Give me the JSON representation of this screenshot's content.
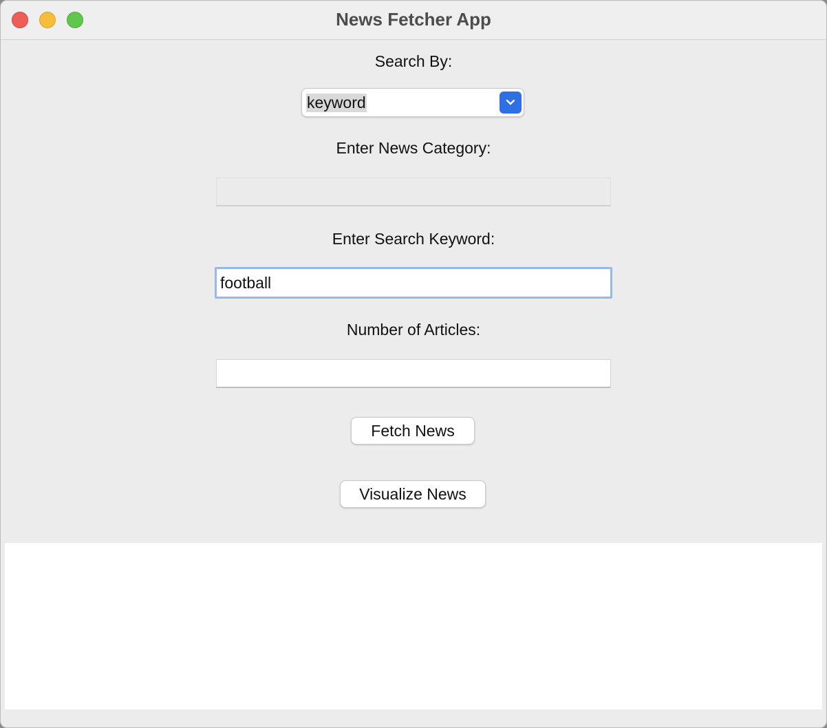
{
  "window": {
    "title": "News Fetcher App"
  },
  "form": {
    "search_by_label": "Search By:",
    "search_by_value": "keyword",
    "category_label": "Enter News Category:",
    "category_value": "",
    "keyword_label": "Enter Search Keyword:",
    "keyword_value": "football",
    "count_label": "Number of Articles:",
    "count_value": ""
  },
  "buttons": {
    "fetch_label": "Fetch News",
    "visualize_label": "Visualize News"
  },
  "colors": {
    "accent": "#2f6fe4",
    "focus_ring": "#97b8ef",
    "close": "#ee5e57",
    "minimize": "#f6bd3b",
    "zoom": "#5fc74b"
  },
  "icons": {
    "dropdown": "chevron-down-icon"
  }
}
